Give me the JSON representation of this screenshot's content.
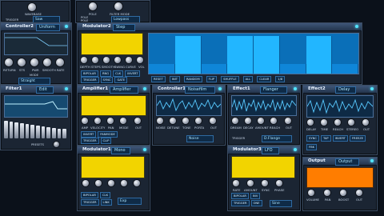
{
  "top_panels": {
    "left": {
      "knobs": [
        "WAVEBASE"
      ],
      "buttons": [
        "TRIGGER"
      ],
      "select": "Saw"
    },
    "mid": {
      "knobs": [
        "POLE",
        "FILTER MODE"
      ],
      "buttons": [
        "POLE",
        "POLE"
      ],
      "select": "Lowpass"
    }
  },
  "controller2": {
    "title": "Controller2",
    "tag": "Uniform",
    "knobs": [
      "RETURN",
      "STS",
      "PWR",
      "SMOOTH",
      "RATE"
    ],
    "mode_label": "MODE",
    "mode_value": "Straight"
  },
  "modulator2": {
    "title": "Modulator2",
    "tag": "Step",
    "knobs": [
      "DEPTH",
      "STEPS",
      "SMOOTH",
      "SWING",
      "CURVE",
      "VOL"
    ],
    "buttons": [
      "BIPOLAR",
      "RNG",
      "CLK",
      "INVERT"
    ],
    "buttons2": [
      "TRIGGER",
      "SYNC",
      "GATE"
    ],
    "seq_buttons": [
      "RESET",
      "INIT",
      "RANDOM",
      "FLIP",
      "SHUFFLE",
      "ALL",
      "CLEAR",
      "1/8"
    ],
    "steps": [
      0.25,
      0.95,
      0.25,
      0.95,
      0.95,
      0.25,
      0.95,
      0.25
    ]
  },
  "filter1": {
    "title": "Filter1",
    "tag": "Edit",
    "sliders": [
      0.92,
      0.88,
      0.84,
      0.8,
      0.76,
      0.72,
      0.68,
      0.64,
      0.6,
      0.56,
      0.52,
      0.5
    ],
    "bottom_label": "PRESETS"
  },
  "amplifier1": {
    "title": "Amplifier1",
    "tag": "Amplifier",
    "knobs": [
      "AMP",
      "VELOCITY",
      "PAN",
      "MODE",
      "OUT"
    ],
    "buttons": [
      "INVERT",
      "PANMODE"
    ],
    "buttons2": [
      "TRIGGER",
      "CLIP"
    ]
  },
  "controller1": {
    "title": "Controller1",
    "tag": "Noisefilm",
    "knobs": [
      "NOISE",
      "DETUNE",
      "TONE",
      "PORTA",
      "OUT"
    ],
    "select": "Noise"
  },
  "effect1": {
    "title": "Effect1",
    "tag": "Flanger",
    "knobs": [
      "DREAM",
      "DECAY",
      "AMOUNT",
      "REACH",
      "OUT"
    ],
    "button": "TRIGGER",
    "select": "D.Flange"
  },
  "effect2": {
    "title": "Effect2",
    "tag": "Delay",
    "knobs": [
      "DELAY",
      "TIME",
      "REACH",
      "STEREO",
      "OUT"
    ],
    "buttons": [
      "SYNC",
      "TAP",
      "INVERT",
      "FREEZE",
      "FBK"
    ]
  },
  "modulator1": {
    "title": "Modulator1",
    "tag": "Mono",
    "buttons": [
      "BIPOLAR",
      "CLK",
      "TRIGGER",
      "LINK"
    ],
    "select": "Exp"
  },
  "modulator3": {
    "title": "Modulator3",
    "tag": "LFO",
    "knobs": [
      "RATE",
      "AMOUNT",
      "SYNC",
      "PHASE"
    ],
    "buttons": [
      "BIPOLAR",
      "INV",
      "TRIGGER",
      "ONE"
    ],
    "select": "Sine"
  },
  "output": {
    "title": "Output",
    "tag": "Output",
    "knobs": [
      "VOLUME",
      "PAN",
      "BOOST",
      "OUT"
    ]
  }
}
